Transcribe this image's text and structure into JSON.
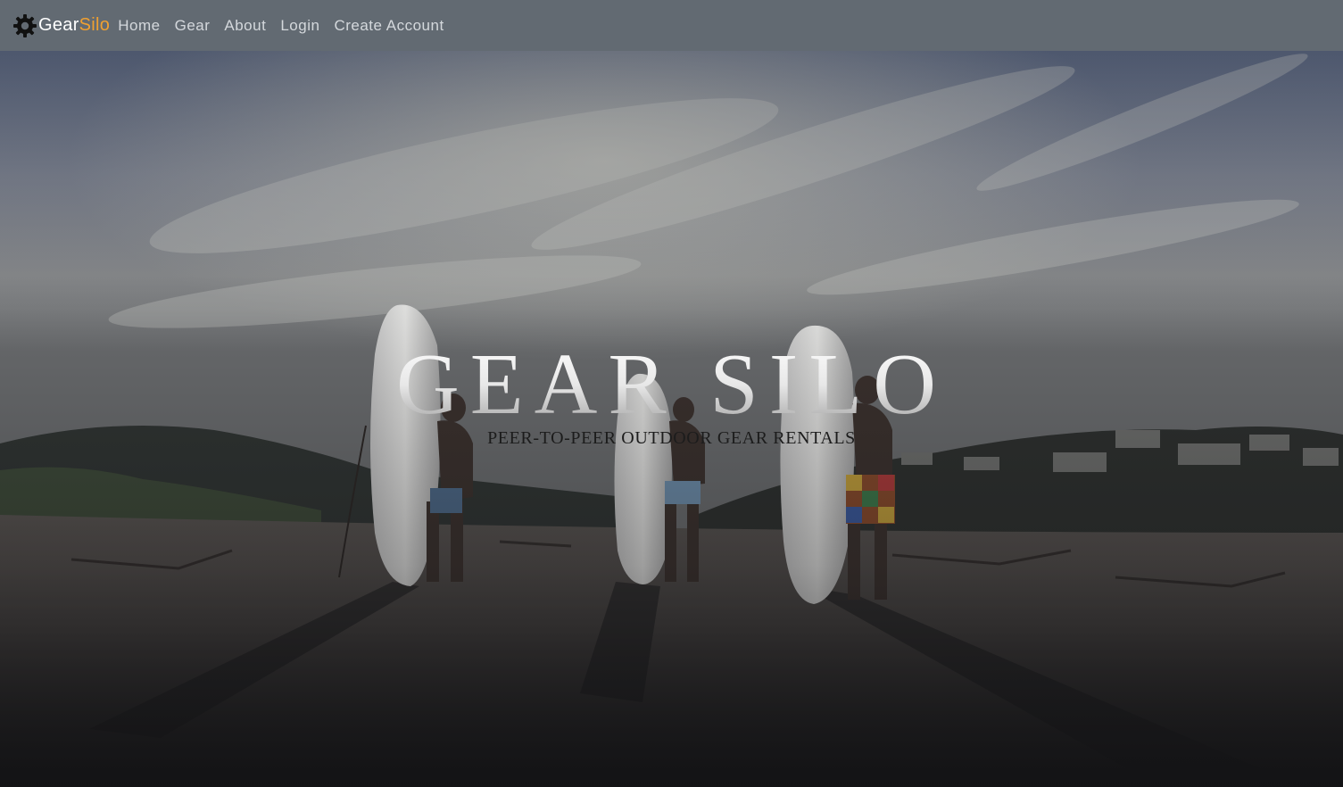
{
  "navbar": {
    "brand": {
      "icon": "gear-icon",
      "text_primary": "Gear",
      "text_accent": "Silo",
      "accent_color": "#f0a030"
    },
    "links": [
      {
        "label": "Home"
      },
      {
        "label": "Gear"
      },
      {
        "label": "About"
      },
      {
        "label": "Login"
      },
      {
        "label": "Create Account"
      }
    ],
    "background_color": "#626a72"
  },
  "hero": {
    "title": "GEAR SILO",
    "subtitle": "PEER-TO-PEER OUTDOOR GEAR RENTALS",
    "image_description_icon": "beach-surfers-photo"
  }
}
